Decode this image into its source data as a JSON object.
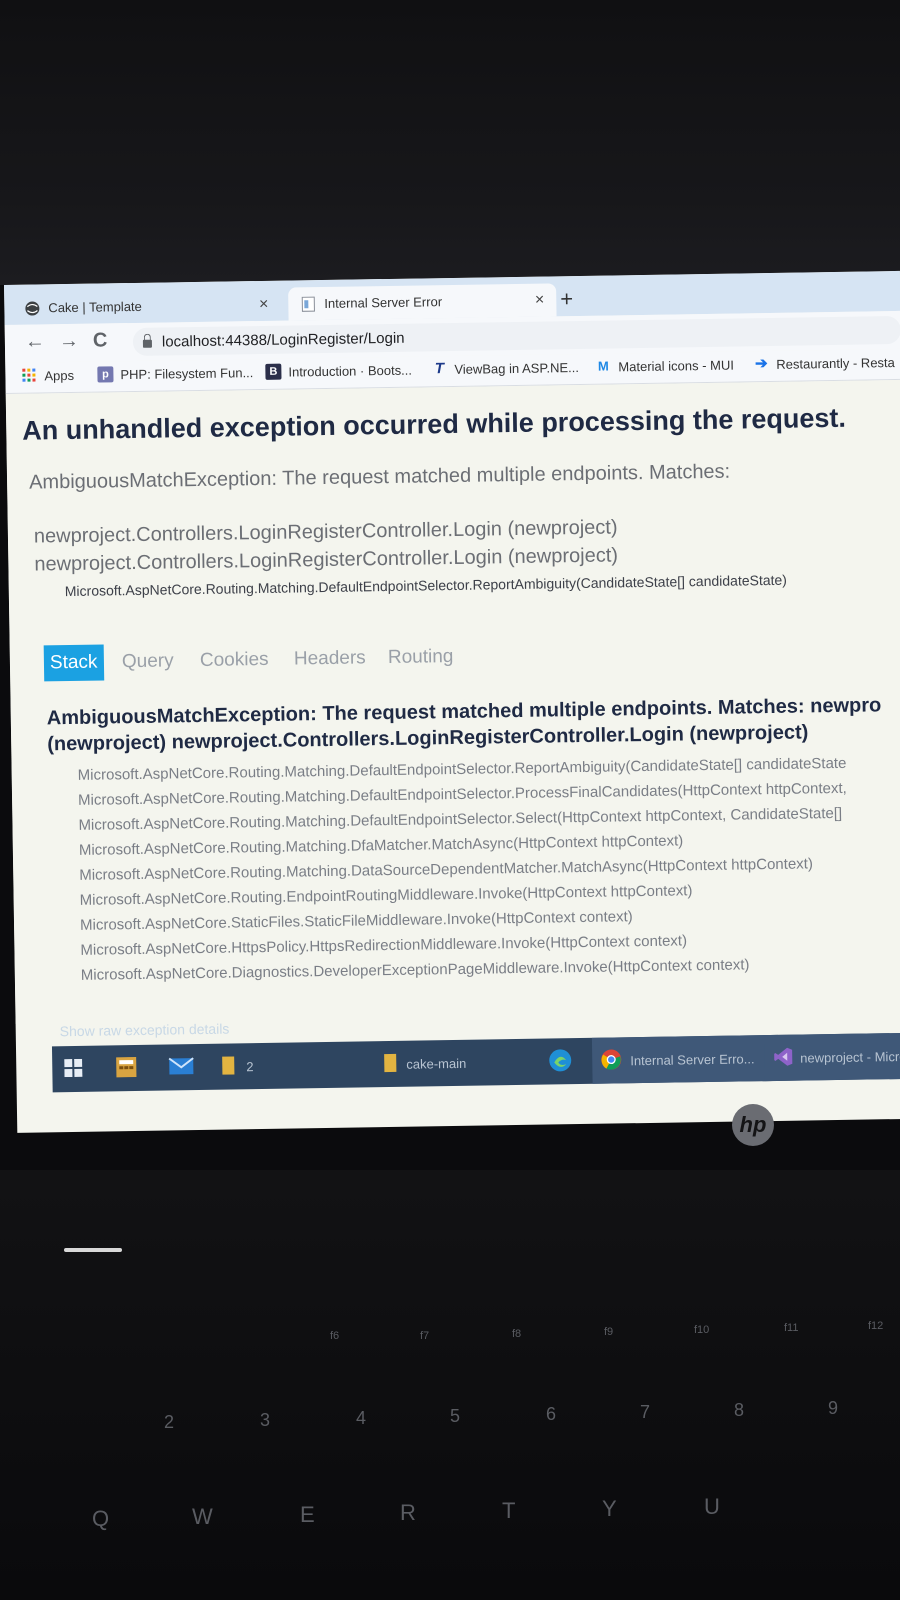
{
  "browser": {
    "tabs": [
      {
        "title": "Cake | Template",
        "close": "×"
      },
      {
        "title": "Internal Server Error",
        "close": "×"
      }
    ],
    "new_tab": "+",
    "nav": {
      "back": "←",
      "forward": "→",
      "reload": "C"
    },
    "url": "localhost:44388/LoginRegister/Login",
    "bookmarks": [
      {
        "label": "Apps",
        "icon": "apps-grid-icon"
      },
      {
        "label": "PHP: Filesystem Fun...",
        "icon": "php-icon"
      },
      {
        "label": "Introduction · Boots...",
        "icon": "bootstrap-icon"
      },
      {
        "label": "ViewBag in ASP.NE...",
        "icon": "t-logo-icon"
      },
      {
        "label": "Material icons - MUI",
        "icon": "mui-icon"
      },
      {
        "label": "Restaurantly - Resta",
        "icon": "restaurantly-icon"
      }
    ]
  },
  "error_page": {
    "heading": "An unhandled exception occurred while processing the request.",
    "message": "AmbiguousMatchException: The request matched multiple endpoints. Matches:",
    "matches": [
      "newproject.Controllers.LoginRegisterController.Login (newproject)",
      "newproject.Controllers.LoginRegisterController.Login (newproject)"
    ],
    "location": "Microsoft.AspNetCore.Routing.Matching.DefaultEndpointSelector.ReportAmbiguity(CandidateState[] candidateState)",
    "tabs": [
      "Stack",
      "Query",
      "Cookies",
      "Headers",
      "Routing"
    ],
    "stack_title_line1": "AmbiguousMatchException: The request matched multiple endpoints. Matches: newpro",
    "stack_title_line2": "(newproject) newproject.Controllers.LoginRegisterController.Login (newproject)",
    "stack_frames": [
      "Microsoft.AspNetCore.Routing.Matching.DefaultEndpointSelector.ReportAmbiguity(CandidateState[] candidateState",
      "Microsoft.AspNetCore.Routing.Matching.DefaultEndpointSelector.ProcessFinalCandidates(HttpContext httpContext,",
      "Microsoft.AspNetCore.Routing.Matching.DefaultEndpointSelector.Select(HttpContext httpContext, CandidateState[]",
      "Microsoft.AspNetCore.Routing.Matching.DfaMatcher.MatchAsync(HttpContext httpContext)",
      "Microsoft.AspNetCore.Routing.Matching.DataSourceDependentMatcher.MatchAsync(HttpContext httpContext)",
      "Microsoft.AspNetCore.Routing.EndpointRoutingMiddleware.Invoke(HttpContext httpContext)",
      "Microsoft.AspNetCore.StaticFiles.StaticFileMiddleware.Invoke(HttpContext context)",
      "Microsoft.AspNetCore.HttpsPolicy.HttpsRedirectionMiddleware.Invoke(HttpContext context)",
      "Microsoft.AspNetCore.Diagnostics.DeveloperExceptionPageMiddleware.Invoke(HttpContext context)"
    ],
    "raw_link": "Show raw exception details"
  },
  "taskbar": {
    "explorer_count": "2",
    "folder_label": "cake-main",
    "chrome_label": "Internal Server Erro...",
    "vs_label": "newproject - Micro"
  },
  "device": {
    "logo": "hp"
  },
  "keyboard": {
    "fn_row": [
      "f6",
      "f7",
      "f8",
      "f9",
      "f10",
      "f11",
      "f12"
    ],
    "num_row": [
      "2",
      "3",
      "4",
      "5",
      "6",
      "7",
      "8",
      "9"
    ],
    "letters": [
      "Q",
      "W",
      "E",
      "R",
      "T",
      "Y",
      "U"
    ]
  },
  "colors": {
    "accent_tab": "#1ba1e2",
    "heading": "#1f2a44",
    "taskbar": "#2e4560"
  }
}
